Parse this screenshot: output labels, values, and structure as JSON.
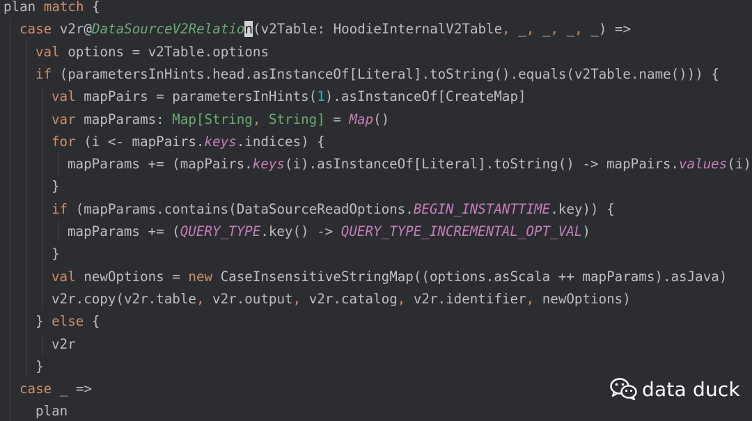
{
  "colors": {
    "background": "#2b2d30",
    "text": "#bcbec4",
    "keyword": "#cf8e6d",
    "type_green": "#6aab73",
    "italic_purple": "#c77dbb",
    "number": "#2aacb8",
    "guide": "#43454a"
  },
  "code_lines": [
    [
      {
        "t": "plan "
      },
      {
        "t": "match",
        "k": "kw"
      },
      {
        "t": " {"
      }
    ],
    [
      {
        "t": "case",
        "k": "kw"
      },
      {
        "t": " v2r@"
      },
      {
        "t": "DataSourceV2Relatio",
        "k": "itg"
      },
      {
        "t": "n",
        "k": "cur"
      },
      {
        "t": "(v2Table: HoodieInternalV2Table"
      },
      {
        "t": ", ",
        "k": "kw"
      },
      {
        "t": "_"
      },
      {
        "t": ", ",
        "k": "kw"
      },
      {
        "t": "_"
      },
      {
        "t": ", ",
        "k": "kw"
      },
      {
        "t": "_"
      },
      {
        "t": ", ",
        "k": "kw"
      },
      {
        "t": "_) =>"
      }
    ],
    [
      {
        "t": "val",
        "k": "kw"
      },
      {
        "t": " options = v2Table.options"
      }
    ],
    [
      {
        "t": "if",
        "k": "kw"
      },
      {
        "t": " (parametersInHints.head.asInstanceOf[Literal].toString().equals(v2Table.name())) {"
      }
    ],
    [
      {
        "t": "val",
        "k": "kw"
      },
      {
        "t": " mapPairs = parametersInHints("
      },
      {
        "t": "1",
        "k": "num"
      },
      {
        "t": ").asInstanceOf[CreateMap]"
      }
    ],
    [
      {
        "t": "var",
        "k": "kw"
      },
      {
        "t": " mapParams: "
      },
      {
        "t": "Map[String",
        "k": "ty"
      },
      {
        "t": ", ",
        "k": "kw"
      },
      {
        "t": "String]",
        "k": "ty"
      },
      {
        "t": " = "
      },
      {
        "t": "Map",
        "k": "it"
      },
      {
        "t": "()"
      }
    ],
    [
      {
        "t": "for",
        "k": "kw"
      },
      {
        "t": " (i <- mapPairs."
      },
      {
        "t": "keys",
        "k": "it"
      },
      {
        "t": ".indices) {"
      }
    ],
    [
      {
        "t": "mapParams += (mapPairs."
      },
      {
        "t": "keys",
        "k": "it"
      },
      {
        "t": "(i).asInstanceOf[Literal].toString() -> mapPairs."
      },
      {
        "t": "values",
        "k": "it"
      },
      {
        "t": "(i)."
      }
    ],
    [
      {
        "t": "}"
      }
    ],
    [
      {
        "t": "if",
        "k": "kw"
      },
      {
        "t": " (mapParams.contains(DataSourceReadOptions."
      },
      {
        "t": "BEGIN_INSTANTTIME",
        "k": "it"
      },
      {
        "t": ".key)) {"
      }
    ],
    [
      {
        "t": "mapParams += ("
      },
      {
        "t": "QUERY_TYPE",
        "k": "it"
      },
      {
        "t": ".key() -> "
      },
      {
        "t": "QUERY_TYPE_INCREMENTAL_OPT_VAL",
        "k": "it"
      },
      {
        "t": ")"
      }
    ],
    [
      {
        "t": "}"
      }
    ],
    [
      {
        "t": "val",
        "k": "kw"
      },
      {
        "t": " newOptions = "
      },
      {
        "t": "new",
        "k": "kw"
      },
      {
        "t": " CaseInsensitiveStringMap((options.asScala ++ mapParams).asJava)"
      }
    ],
    [
      {
        "t": "v2r.copy(v2r.table"
      },
      {
        "t": ", ",
        "k": "kw"
      },
      {
        "t": "v2r.output"
      },
      {
        "t": ", ",
        "k": "kw"
      },
      {
        "t": "v2r.catalog"
      },
      {
        "t": ", ",
        "k": "kw"
      },
      {
        "t": "v2r.identifier"
      },
      {
        "t": ", ",
        "k": "kw"
      },
      {
        "t": "newOptions)"
      }
    ],
    [
      {
        "t": "} "
      },
      {
        "t": "else",
        "k": "kw"
      },
      {
        "t": " {"
      }
    ],
    [
      {
        "t": "v2r"
      }
    ],
    [
      {
        "t": "}"
      }
    ],
    [
      {
        "t": "case",
        "k": "kw"
      },
      {
        "t": " _ =>"
      }
    ],
    [
      {
        "t": "plan"
      }
    ]
  ],
  "watermark": {
    "icon": "wechat-icon",
    "text": "data duck"
  }
}
